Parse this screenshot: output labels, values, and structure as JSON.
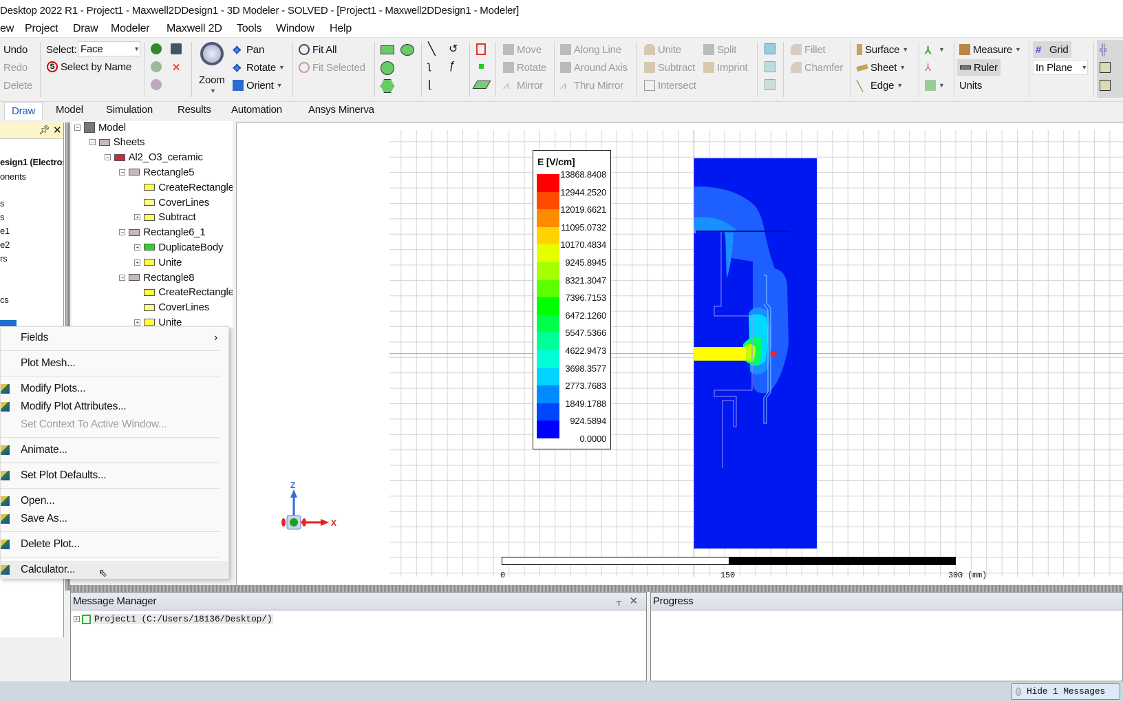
{
  "window": {
    "title": "Desktop 2022 R1 - Project1 - Maxwell2DDesign1 - 3D Modeler - SOLVED - [Project1 - Maxwell2DDesign1 - Modeler]"
  },
  "menu": [
    "ew",
    "Project",
    "Draw",
    "Modeler",
    "Maxwell 2D",
    "Tools",
    "Window",
    "Help"
  ],
  "ribbon": {
    "undo": "Undo",
    "redo": "Redo",
    "delete": "Delete",
    "select_label": "Select:",
    "select_value": "Face",
    "select_by_name": "Select by Name",
    "zoom": "Zoom",
    "pan": "Pan",
    "rotate": "Rotate",
    "orient": "Orient",
    "fit_all": "Fit All",
    "fit_selected": "Fit Selected",
    "move": "Move",
    "rotate2": "Rotate",
    "mirror": "Mirror",
    "along_line": "Along Line",
    "around_axis": "Around Axis",
    "thru_mirror": "Thru Mirror",
    "unite": "Unite",
    "subtract": "Subtract",
    "intersect": "Intersect",
    "split": "Split",
    "imprint": "Imprint",
    "fillet": "Fillet",
    "chamfer": "Chamfer",
    "surface": "Surface",
    "sheet": "Sheet",
    "edge": "Edge",
    "measure": "Measure",
    "ruler": "Ruler",
    "units": "Units",
    "grid": "Grid",
    "plane_value": "In Plane"
  },
  "tabs": [
    {
      "label": "Draw",
      "active": true
    },
    {
      "label": "Model"
    },
    {
      "label": "Simulation"
    },
    {
      "label": "Results"
    },
    {
      "label": "Automation"
    },
    {
      "label": "Ansys Minerva"
    }
  ],
  "project_panel": {
    "items": [
      "esign1 (Electros",
      "onents",
      "s",
      "s",
      "e1",
      "e2",
      "rs",
      "cs"
    ]
  },
  "model_tree": [
    {
      "label": "Model",
      "level": 0,
      "toggle": "-",
      "icon": "model-icon"
    },
    {
      "label": "Sheets",
      "level": 1,
      "toggle": "-",
      "icon": "sheet-icon"
    },
    {
      "label": "Al2_O3_ceramic",
      "level": 2,
      "toggle": "-",
      "icon": "material-icon"
    },
    {
      "label": "Rectangle5",
      "level": 3,
      "toggle": "-",
      "icon": "sheet-icon"
    },
    {
      "label": "CreateRectangle",
      "level": 4,
      "toggle": "",
      "icon": "create-rect-icon"
    },
    {
      "label": "CoverLines",
      "level": 4,
      "toggle": "",
      "icon": "cover-lines-icon"
    },
    {
      "label": "Subtract",
      "level": 4,
      "toggle": "+",
      "icon": "subtract-icon"
    },
    {
      "label": "Rectangle6_1",
      "level": 3,
      "toggle": "-",
      "icon": "sheet-icon"
    },
    {
      "label": "DuplicateBody",
      "level": 4,
      "toggle": "+",
      "icon": "duplicate-icon"
    },
    {
      "label": "Unite",
      "level": 4,
      "toggle": "+",
      "icon": "unite-icon"
    },
    {
      "label": "Rectangle8",
      "level": 3,
      "toggle": "-",
      "icon": "sheet-icon"
    },
    {
      "label": "CreateRectangle",
      "level": 4,
      "toggle": "",
      "icon": "create-rect-icon"
    },
    {
      "label": "CoverLines",
      "level": 4,
      "toggle": "",
      "icon": "cover-lines-icon"
    },
    {
      "label": "Unite",
      "level": 4,
      "toggle": "+",
      "icon": "unite-icon"
    }
  ],
  "context_menu": [
    {
      "label": "Fields",
      "submenu": true
    },
    {
      "sep": true
    },
    {
      "label": "Plot Mesh..."
    },
    {
      "sep": true
    },
    {
      "label": "Modify Plots...",
      "icon": "modify-plots-icon"
    },
    {
      "label": "Modify Plot Attributes...",
      "icon": "modify-attributes-icon"
    },
    {
      "label": "Set Context To Active Window...",
      "disabled": true
    },
    {
      "sep": true
    },
    {
      "label": "Animate...",
      "icon": "animate-icon"
    },
    {
      "sep": true
    },
    {
      "label": "Set Plot Defaults...",
      "icon": "plot-defaults-icon"
    },
    {
      "sep": true
    },
    {
      "label": "Open...",
      "icon": "open-icon"
    },
    {
      "label": "Save As...",
      "icon": "save-as-icon"
    },
    {
      "sep": true
    },
    {
      "label": "Delete Plot...",
      "icon": "delete-plot-icon"
    },
    {
      "sep": true
    },
    {
      "label": "Calculator...",
      "icon": "calculator-icon",
      "hover": true
    }
  ],
  "legend": {
    "title": "E [V/cm]",
    "values": [
      "13868.8408",
      "12944.2520",
      "12019.6621",
      "11095.0732",
      "10170.4834",
      "9245.8945",
      "8321.3047",
      "7396.7153",
      "6472.1260",
      "5547.5366",
      "4622.9473",
      "3698.3577",
      "2773.7683",
      "1849.1788",
      "924.5894",
      "0.0000"
    ],
    "colors": [
      "#ff0000",
      "#ff4a00",
      "#ff8c00",
      "#ffd200",
      "#e4ff00",
      "#a6ff00",
      "#5cff00",
      "#00ff00",
      "#00ff4c",
      "#00ff98",
      "#00ffd8",
      "#00d4ff",
      "#008cff",
      "#0046ff",
      "#0000ff"
    ]
  },
  "scale_bar": {
    "labels": [
      "0",
      "150",
      "300 (mm)"
    ]
  },
  "axes": {
    "z": "Z",
    "x": "X"
  },
  "message_manager": {
    "title": "Message Manager",
    "entry": "Project1 (C:/Users/18136/Desktop/)"
  },
  "progress": {
    "title": "Progress"
  },
  "status": {
    "hide_messages": "Hide 1 Messages"
  }
}
